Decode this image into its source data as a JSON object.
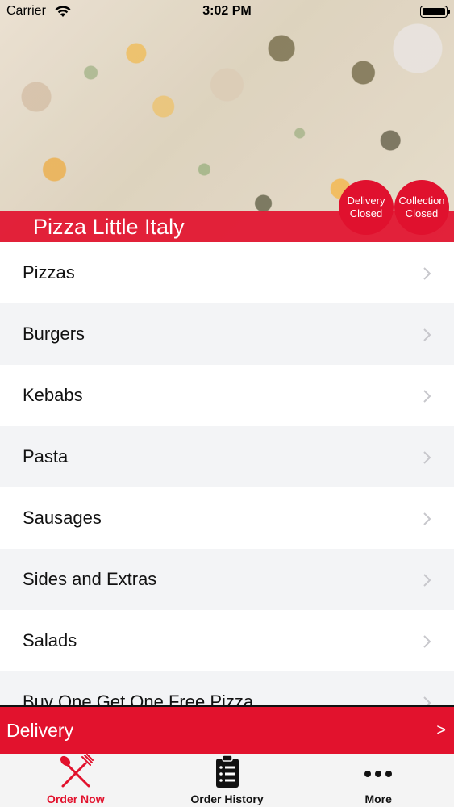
{
  "status_bar": {
    "carrier": "Carrier",
    "time": "3:02 PM"
  },
  "hero": {
    "restaurant_name": "Pizza Little Italy",
    "delivery_status": {
      "line1": "Delivery",
      "line2": "Closed"
    },
    "collection_status": {
      "line1": "Collection",
      "line2": "Closed"
    }
  },
  "menu": {
    "items": [
      {
        "label": "Pizzas"
      },
      {
        "label": "Burgers"
      },
      {
        "label": "Kebabs"
      },
      {
        "label": "Pasta"
      },
      {
        "label": "Sausages"
      },
      {
        "label": "Sides and Extras"
      },
      {
        "label": "Salads"
      },
      {
        "label": "Buy One Get One Free Pizza"
      }
    ]
  },
  "delivery_bar": {
    "label": "Delivery",
    "arrow": ">"
  },
  "tabs": [
    {
      "label": "Order Now",
      "icon": "fork-knife-icon"
    },
    {
      "label": "Order History",
      "icon": "clipboard-icon"
    },
    {
      "label": "More",
      "icon": "more-dots-icon"
    }
  ],
  "colors": {
    "accent": "#e2122d",
    "alt_row": "#f3f4f6",
    "tab_bar": "#f4f4f4"
  }
}
